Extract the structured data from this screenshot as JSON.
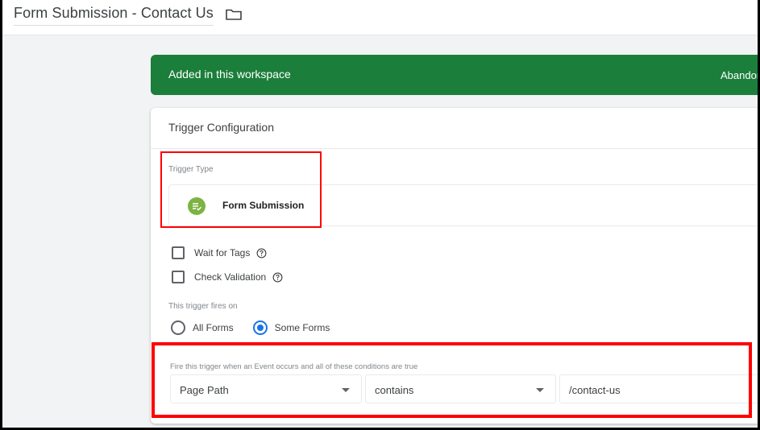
{
  "header": {
    "title": "Form Submission - Contact Us",
    "folder_icon": "folder-icon"
  },
  "banner": {
    "message": "Added in this workspace",
    "action_label": "Abandon",
    "color": "#1b7e3b"
  },
  "trigger_config": {
    "heading": "Trigger Configuration",
    "trigger_type_label": "Trigger Type",
    "trigger_type_name": "Form Submission",
    "trigger_type_icon": "form-check-icon",
    "options": [
      {
        "label": "Wait for Tags",
        "checked": false
      },
      {
        "label": "Check Validation",
        "checked": false
      }
    ],
    "fires_on_label": "This trigger fires on",
    "fires_on_options": [
      {
        "label": "All Forms",
        "selected": false
      },
      {
        "label": "Some Forms",
        "selected": true
      }
    ],
    "condition_label": "Fire this trigger when an Event occurs and all of these conditions are true",
    "condition": {
      "variable": "Page Path",
      "operator": "contains",
      "value": "/contact-us"
    }
  },
  "annotations": {
    "highlight_color": "#ff0000"
  }
}
